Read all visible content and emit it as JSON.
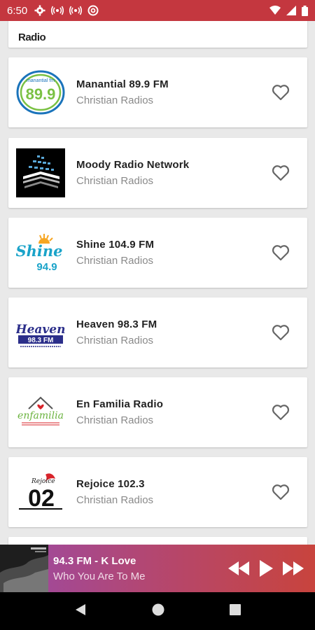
{
  "status_bar": {
    "time": "6:50",
    "left_icons": [
      "gear-icon",
      "broadcast-icon",
      "broadcast-icon",
      "at-sign-icon"
    ],
    "right_icons": [
      "wifi-icon",
      "signal-icon",
      "battery-icon"
    ]
  },
  "partial_card": {
    "text": "Radio"
  },
  "stations": [
    {
      "name": "Manantial 89.9 FM",
      "genre": "Christian Radios",
      "logo": "manantial-logo"
    },
    {
      "name": "Moody Radio Network",
      "genre": "Christian Radios",
      "logo": "moody-logo"
    },
    {
      "name": "Shine 104.9 FM",
      "genre": "Christian Radios",
      "logo": "shine-logo"
    },
    {
      "name": "Heaven 98.3 FM",
      "genre": "Christian Radios",
      "logo": "heaven-logo"
    },
    {
      "name": "En Familia Radio",
      "genre": "Christian Radios",
      "logo": "enfamilia-logo"
    },
    {
      "name": "Rejoice 102.3",
      "genre": "Christian Radios",
      "logo": "rejoice-logo"
    }
  ],
  "logo_text": {
    "manantial_small": "manantial fm",
    "manantial_big": "89.9",
    "shine": "Shine",
    "shine_freq": "94.9",
    "heaven": "Heaven",
    "heaven_freq": "98.3 FM",
    "enfamilia": "enfamilia",
    "rejoice_small": "Rejoice",
    "rejoice_big": "02"
  },
  "player": {
    "title": "94.3 FM - K Love",
    "subtitle": "Who You Are To Me"
  },
  "colors": {
    "status_bar": "#c4373f",
    "player_start": "#9b4aa5",
    "player_end": "#c8443d"
  }
}
